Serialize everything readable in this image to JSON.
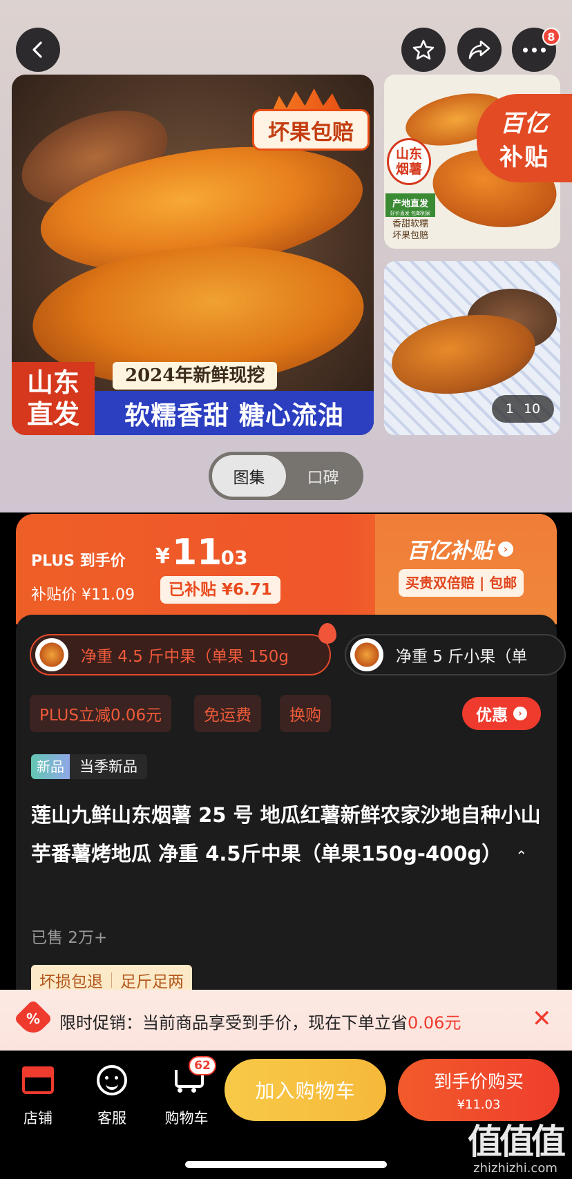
{
  "gallery": {
    "badge_bad_fruit": "坏果包赔",
    "banner_origin_line1": "山东",
    "banner_origin_line2": "直发",
    "banner_year": "2024年新鲜现挖",
    "banner_slogan": "软糯香甜 糖心流油",
    "thumb1_label_place": "山东\n烟薯",
    "thumb1_label_direct": "产地直发",
    "thumb1_label_small": "好价直发 包邮到家",
    "thumb1_label_desc": "香甜软糯\n坏果包赔",
    "subsidy_badge_line1": "百亿",
    "subsidy_badge_line2": "补贴",
    "counter_current": "1",
    "counter_total": "10",
    "tabs": [
      "图集",
      "口碑"
    ],
    "message_count": "8"
  },
  "price": {
    "plus_label": "PLUS 到手价",
    "currency": "¥",
    "price_int": "11",
    "price_dec": ".03",
    "subsidy_price_label": "补贴价 ¥11.09",
    "subsidized_tag": "已补贴 ¥6.71",
    "brand": "百亿补贴",
    "guarantee": "买贵双倍赔 | 包邮"
  },
  "sku": [
    {
      "label": "净重 4.5 斤中果（单果 150g"
    },
    {
      "label": "净重 5 斤小果（单"
    }
  ],
  "promos": [
    "PLUS立减0.06元",
    "免运费",
    "换购"
  ],
  "youhui": "优惠",
  "new_tag": {
    "a": "新品",
    "b": "当季新品"
  },
  "title": "莲山九鲜山东烟薯 25 号 地瓜红薯新鲜农家沙地自种小山芋番薯烤地瓜 净重 4.5斤中果（单果150g-400g）",
  "title_toggle": "⌃",
  "sold": "已售 2万+",
  "services": [
    "坏损包退",
    "足斤足两"
  ],
  "promo_bar": {
    "icon": "%",
    "text": "限时促销：当前商品享受到手价，现在下单立省",
    "amount": "0.06元",
    "close": "✕"
  },
  "bottom": {
    "store": "店铺",
    "service": "客服",
    "cart": "购物车",
    "cart_badge": "62",
    "add_cart": "加入购物车",
    "buy_label": "到手价购买",
    "buy_price": "¥11.03"
  },
  "watermark": {
    "big": "值值值",
    "small": "zhizhizhi.com"
  },
  "colors": {
    "accent": "#ef3b2e",
    "orange": "#ee5f27",
    "yellow": "#f8c948"
  }
}
